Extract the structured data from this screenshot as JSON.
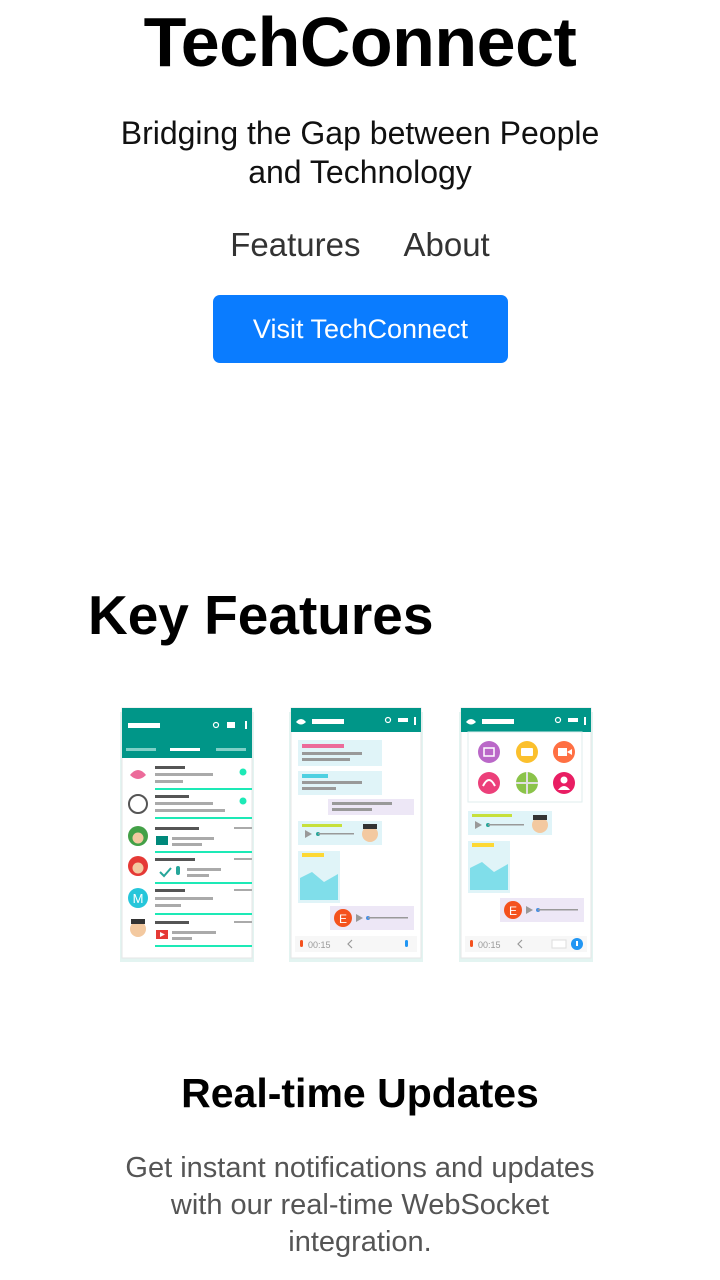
{
  "header": {
    "title": "TechConnect",
    "subtitle": "Bridging the Gap between People and Technology"
  },
  "nav": {
    "items": [
      {
        "label": "Features"
      },
      {
        "label": "About"
      }
    ]
  },
  "cta": {
    "label": "Visit TechConnect"
  },
  "features": {
    "section_title": "Key Features",
    "illustration": {
      "phone2_timer": "00:15",
      "phone3_timer": "00:15",
      "avatar_letter_m": "M",
      "avatar_letter_e": "E"
    },
    "items": [
      {
        "title": "Real-time Updates",
        "description": "Get instant notifications and updates with our real-time WebSocket integration."
      }
    ]
  },
  "colors": {
    "accent": "#0a7cff",
    "brand_teal": "#009688",
    "text_muted": "#555555"
  }
}
